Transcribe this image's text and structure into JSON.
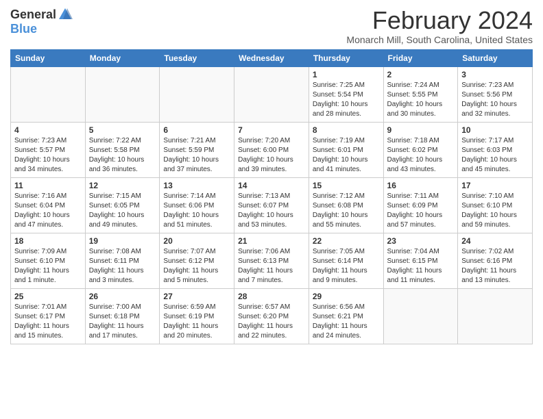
{
  "header": {
    "logo_general": "General",
    "logo_blue": "Blue",
    "month_title": "February 2024",
    "location": "Monarch Mill, South Carolina, United States"
  },
  "weekdays": [
    "Sunday",
    "Monday",
    "Tuesday",
    "Wednesday",
    "Thursday",
    "Friday",
    "Saturday"
  ],
  "weeks": [
    [
      {
        "day": "",
        "empty": true
      },
      {
        "day": "",
        "empty": true
      },
      {
        "day": "",
        "empty": true
      },
      {
        "day": "",
        "empty": true
      },
      {
        "day": "1",
        "sunrise": "Sunrise: 7:25 AM",
        "sunset": "Sunset: 5:54 PM",
        "daylight": "Daylight: 10 hours and 28 minutes."
      },
      {
        "day": "2",
        "sunrise": "Sunrise: 7:24 AM",
        "sunset": "Sunset: 5:55 PM",
        "daylight": "Daylight: 10 hours and 30 minutes."
      },
      {
        "day": "3",
        "sunrise": "Sunrise: 7:23 AM",
        "sunset": "Sunset: 5:56 PM",
        "daylight": "Daylight: 10 hours and 32 minutes."
      }
    ],
    [
      {
        "day": "4",
        "sunrise": "Sunrise: 7:23 AM",
        "sunset": "Sunset: 5:57 PM",
        "daylight": "Daylight: 10 hours and 34 minutes."
      },
      {
        "day": "5",
        "sunrise": "Sunrise: 7:22 AM",
        "sunset": "Sunset: 5:58 PM",
        "daylight": "Daylight: 10 hours and 36 minutes."
      },
      {
        "day": "6",
        "sunrise": "Sunrise: 7:21 AM",
        "sunset": "Sunset: 5:59 PM",
        "daylight": "Daylight: 10 hours and 37 minutes."
      },
      {
        "day": "7",
        "sunrise": "Sunrise: 7:20 AM",
        "sunset": "Sunset: 6:00 PM",
        "daylight": "Daylight: 10 hours and 39 minutes."
      },
      {
        "day": "8",
        "sunrise": "Sunrise: 7:19 AM",
        "sunset": "Sunset: 6:01 PM",
        "daylight": "Daylight: 10 hours and 41 minutes."
      },
      {
        "day": "9",
        "sunrise": "Sunrise: 7:18 AM",
        "sunset": "Sunset: 6:02 PM",
        "daylight": "Daylight: 10 hours and 43 minutes."
      },
      {
        "day": "10",
        "sunrise": "Sunrise: 7:17 AM",
        "sunset": "Sunset: 6:03 PM",
        "daylight": "Daylight: 10 hours and 45 minutes."
      }
    ],
    [
      {
        "day": "11",
        "sunrise": "Sunrise: 7:16 AM",
        "sunset": "Sunset: 6:04 PM",
        "daylight": "Daylight: 10 hours and 47 minutes."
      },
      {
        "day": "12",
        "sunrise": "Sunrise: 7:15 AM",
        "sunset": "Sunset: 6:05 PM",
        "daylight": "Daylight: 10 hours and 49 minutes."
      },
      {
        "day": "13",
        "sunrise": "Sunrise: 7:14 AM",
        "sunset": "Sunset: 6:06 PM",
        "daylight": "Daylight: 10 hours and 51 minutes."
      },
      {
        "day": "14",
        "sunrise": "Sunrise: 7:13 AM",
        "sunset": "Sunset: 6:07 PM",
        "daylight": "Daylight: 10 hours and 53 minutes."
      },
      {
        "day": "15",
        "sunrise": "Sunrise: 7:12 AM",
        "sunset": "Sunset: 6:08 PM",
        "daylight": "Daylight: 10 hours and 55 minutes."
      },
      {
        "day": "16",
        "sunrise": "Sunrise: 7:11 AM",
        "sunset": "Sunset: 6:09 PM",
        "daylight": "Daylight: 10 hours and 57 minutes."
      },
      {
        "day": "17",
        "sunrise": "Sunrise: 7:10 AM",
        "sunset": "Sunset: 6:10 PM",
        "daylight": "Daylight: 10 hours and 59 minutes."
      }
    ],
    [
      {
        "day": "18",
        "sunrise": "Sunrise: 7:09 AM",
        "sunset": "Sunset: 6:10 PM",
        "daylight": "Daylight: 11 hours and 1 minute."
      },
      {
        "day": "19",
        "sunrise": "Sunrise: 7:08 AM",
        "sunset": "Sunset: 6:11 PM",
        "daylight": "Daylight: 11 hours and 3 minutes."
      },
      {
        "day": "20",
        "sunrise": "Sunrise: 7:07 AM",
        "sunset": "Sunset: 6:12 PM",
        "daylight": "Daylight: 11 hours and 5 minutes."
      },
      {
        "day": "21",
        "sunrise": "Sunrise: 7:06 AM",
        "sunset": "Sunset: 6:13 PM",
        "daylight": "Daylight: 11 hours and 7 minutes."
      },
      {
        "day": "22",
        "sunrise": "Sunrise: 7:05 AM",
        "sunset": "Sunset: 6:14 PM",
        "daylight": "Daylight: 11 hours and 9 minutes."
      },
      {
        "day": "23",
        "sunrise": "Sunrise: 7:04 AM",
        "sunset": "Sunset: 6:15 PM",
        "daylight": "Daylight: 11 hours and 11 minutes."
      },
      {
        "day": "24",
        "sunrise": "Sunrise: 7:02 AM",
        "sunset": "Sunset: 6:16 PM",
        "daylight": "Daylight: 11 hours and 13 minutes."
      }
    ],
    [
      {
        "day": "25",
        "sunrise": "Sunrise: 7:01 AM",
        "sunset": "Sunset: 6:17 PM",
        "daylight": "Daylight: 11 hours and 15 minutes."
      },
      {
        "day": "26",
        "sunrise": "Sunrise: 7:00 AM",
        "sunset": "Sunset: 6:18 PM",
        "daylight": "Daylight: 11 hours and 17 minutes."
      },
      {
        "day": "27",
        "sunrise": "Sunrise: 6:59 AM",
        "sunset": "Sunset: 6:19 PM",
        "daylight": "Daylight: 11 hours and 20 minutes."
      },
      {
        "day": "28",
        "sunrise": "Sunrise: 6:57 AM",
        "sunset": "Sunset: 6:20 PM",
        "daylight": "Daylight: 11 hours and 22 minutes."
      },
      {
        "day": "29",
        "sunrise": "Sunrise: 6:56 AM",
        "sunset": "Sunset: 6:21 PM",
        "daylight": "Daylight: 11 hours and 24 minutes."
      },
      {
        "day": "",
        "empty": true
      },
      {
        "day": "",
        "empty": true
      }
    ]
  ]
}
